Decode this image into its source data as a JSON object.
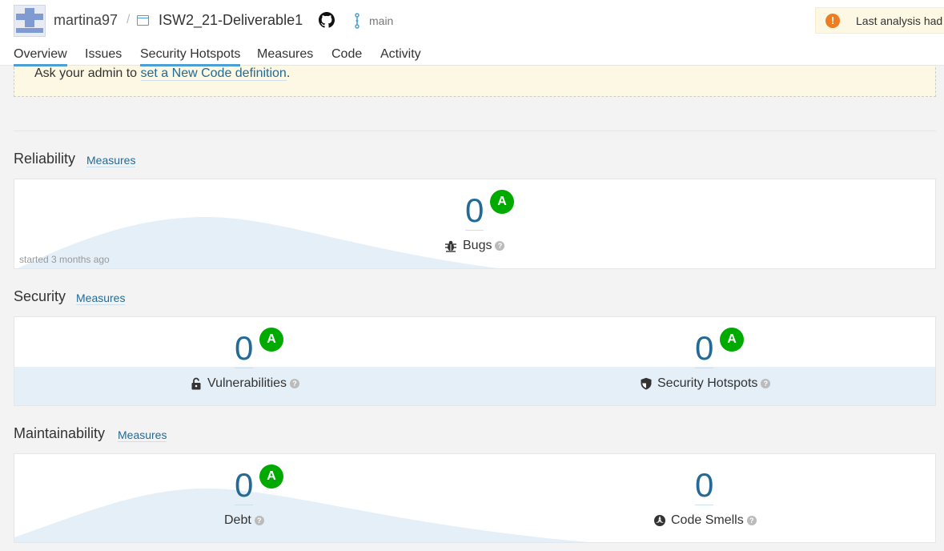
{
  "header": {
    "org": "martina97",
    "separator": "/",
    "project": "ISW2_21-Deliverable1",
    "branch": "main",
    "warning_text": "Last analysis had"
  },
  "tabs": [
    "Overview",
    "Issues",
    "Security Hotspots",
    "Measures",
    "Code",
    "Activity"
  ],
  "banner": {
    "prefix": "Ask your admin to ",
    "link": "set a New Code definition",
    "suffix": "."
  },
  "reliability": {
    "title": "Reliability",
    "measures_link": "Measures",
    "bugs_value": "0",
    "bugs_rating": "A",
    "bugs_label": "Bugs",
    "started": "started 3 months ago"
  },
  "security": {
    "title": "Security",
    "measures_link": "Measures",
    "vuln_value": "0",
    "vuln_rating": "A",
    "vuln_label": "Vulnerabilities",
    "hotspots_value": "0",
    "hotspots_rating": "A",
    "hotspots_label": "Security Hotspots"
  },
  "maintainability": {
    "title": "Maintainability",
    "measures_link": "Measures",
    "debt_value": "0",
    "debt_rating": "A",
    "debt_label": "Debt",
    "smells_value": "0",
    "smells_label": "Code Smells"
  },
  "help_glyph": "?",
  "warn_glyph": "!",
  "colors": {
    "link": "#236a97",
    "rating_a": "#00aa00",
    "banner_bg": "#fcf8e3",
    "tab_underline": "#4b9fd5",
    "warning_icon": "#ed7d20"
  }
}
